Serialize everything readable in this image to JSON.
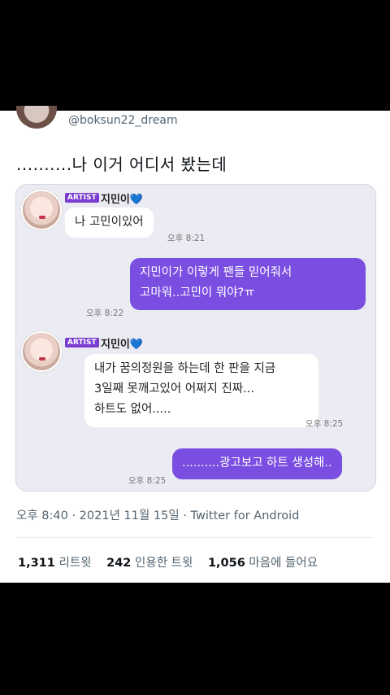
{
  "tweet": {
    "handle": "@boksun22_dream",
    "text": "..........나 이거 어디서 봤는데",
    "meta_time": "오후 8:40 · 2021년 11월 15일 · ",
    "meta_source": "Twitter for Android",
    "retweets_count": "1,311",
    "retweets_label": "리트윗",
    "quotes_count": "242",
    "quotes_label": "인용한 트윗",
    "likes_count": "1,056",
    "likes_label": "마음에 들어요"
  },
  "chat": {
    "artist_badge": "ARTIST",
    "artist_name": "지민이",
    "heart": "💙",
    "messages": [
      {
        "text": "나 고민이있어",
        "time": "오후 8:21"
      },
      {
        "line1": "지민이가 이렇게 팬들 믿어줘서",
        "line2": "고마워..고민이 뭐야?ㅠ",
        "time": "오후 8:22"
      },
      {
        "line1": "내가 꿈의정원을 하는데 한 판을 지금",
        "line2": "3일째 못깨고있어 어쩌지 진짜...",
        "line3": "하트도 없어.....",
        "time": "오후 8:25"
      },
      {
        "text": "..........광고보고 하트 생성해..",
        "time": "오후 8:25"
      }
    ]
  }
}
